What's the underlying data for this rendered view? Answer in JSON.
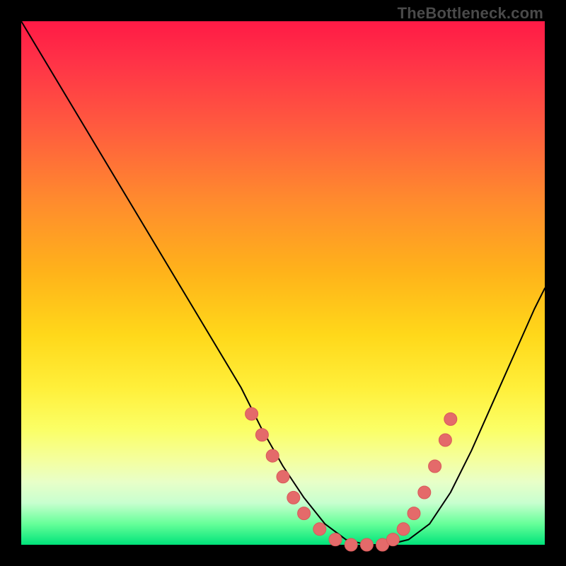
{
  "watermark": "TheBottleneck.com",
  "colors": {
    "dot": "#e46a6a",
    "curve": "#000000",
    "gradient_top": "#ff1a46",
    "gradient_bottom": "#00e37a"
  },
  "chart_data": {
    "type": "line",
    "title": "",
    "xlabel": "",
    "ylabel": "",
    "xlim": [
      0,
      100
    ],
    "ylim": [
      0,
      100
    ],
    "grid": false,
    "legend": false,
    "series": [
      {
        "name": "bottleneck-curve",
        "x": [
          0,
          6,
          12,
          18,
          24,
          30,
          36,
          42,
          46,
          50,
          54,
          58,
          62,
          66,
          70,
          74,
          78,
          82,
          86,
          90,
          94,
          98,
          100
        ],
        "y": [
          100,
          90,
          80,
          70,
          60,
          50,
          40,
          30,
          22,
          15,
          9,
          4,
          1,
          0,
          0,
          1,
          4,
          10,
          18,
          27,
          36,
          45,
          49
        ]
      }
    ],
    "markers": [
      {
        "x": 44,
        "y": 25
      },
      {
        "x": 46,
        "y": 21
      },
      {
        "x": 48,
        "y": 17
      },
      {
        "x": 50,
        "y": 13
      },
      {
        "x": 52,
        "y": 9
      },
      {
        "x": 54,
        "y": 6
      },
      {
        "x": 57,
        "y": 3
      },
      {
        "x": 60,
        "y": 1
      },
      {
        "x": 63,
        "y": 0
      },
      {
        "x": 66,
        "y": 0
      },
      {
        "x": 69,
        "y": 0
      },
      {
        "x": 71,
        "y": 1
      },
      {
        "x": 73,
        "y": 3
      },
      {
        "x": 75,
        "y": 6
      },
      {
        "x": 77,
        "y": 10
      },
      {
        "x": 79,
        "y": 15
      },
      {
        "x": 81,
        "y": 20
      },
      {
        "x": 82,
        "y": 24
      }
    ]
  }
}
